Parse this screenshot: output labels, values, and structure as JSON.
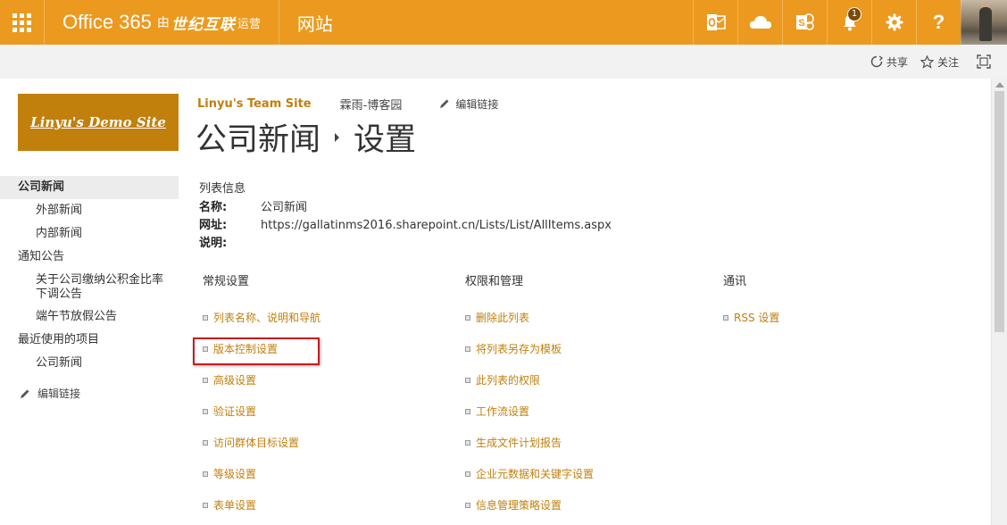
{
  "suite_bar": {
    "brand_office": "Office 365",
    "brand_by": "由",
    "brand_partner": "世纪互联",
    "brand_operated": "运营",
    "site_label": "网站",
    "notification_count": "1",
    "help_label": "?",
    "accent_color": "#eb9a1f"
  },
  "ribbon": {
    "share_label": "共享",
    "follow_label": "关注"
  },
  "site_logo": {
    "text": "Linyu's Demo Site"
  },
  "top_nav": {
    "site_name": "Linyu's Team Site",
    "link": "霖雨-博客园",
    "edit_links": "编辑链接"
  },
  "page_title": {
    "list_name": "公司新闻",
    "page": "设置"
  },
  "left_nav": {
    "items": [
      {
        "label": "公司新闻",
        "level": 0,
        "selected": true
      },
      {
        "label": "外部新闻",
        "level": 1
      },
      {
        "label": "内部新闻",
        "level": 1
      },
      {
        "label": "通知公告",
        "level": 0
      },
      {
        "label": "关于公司缴纳公积金比率下调公告",
        "level": 1
      },
      {
        "label": "端午节放假公告",
        "level": 1
      },
      {
        "label": "最近使用的项目",
        "level": 0
      },
      {
        "label": "公司新闻",
        "level": 1
      }
    ],
    "edit_links": "编辑链接"
  },
  "list_info": {
    "heading": "列表信息",
    "name_label": "名称:",
    "name_value": "公司新闻",
    "url_label": "网址:",
    "url_value": "https://gallatinms2016.sharepoint.cn/Lists/List/AllItems.aspx",
    "desc_label": "说明:"
  },
  "settings": {
    "general": {
      "heading": "常规设置",
      "items": [
        "列表名称、说明和导航",
        "版本控制设置",
        "高级设置",
        "验证设置",
        "访问群体目标设置",
        "等级设置",
        "表单设置"
      ]
    },
    "permissions": {
      "heading": "权限和管理",
      "items": [
        "删除此列表",
        "将列表另存为模板",
        "此列表的权限",
        "工作流设置",
        "生成文件计划报告",
        "企业元数据和关键字设置",
        "信息管理策略设置"
      ]
    },
    "communications": {
      "heading": "通讯",
      "items": [
        "RSS 设置"
      ]
    }
  }
}
